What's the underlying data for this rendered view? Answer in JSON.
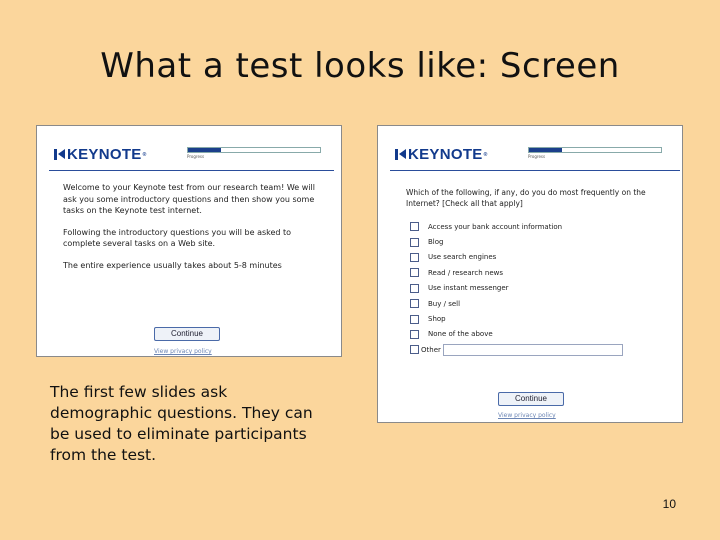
{
  "slide": {
    "title": "What a test looks like: Screen",
    "caption": "The first few slides ask demographic questions. They can be used to eliminate participants from the test.",
    "page_number": "10"
  },
  "shot1": {
    "logo": "KEYNOTE",
    "logo_tm": "®",
    "progress": 0.25,
    "progress_label": "Progress",
    "paragraphs": [
      "Welcome to your Keynote test from our research team! We will ask you some introductory questions and then show you some tasks on the Keynote test internet.",
      "Following the introductory questions you will be asked to complete several tasks on a Web site.",
      "The entire experience usually takes about 5-8 minutes"
    ],
    "continue_label": "Continue",
    "privacy_label": "View privacy policy"
  },
  "shot2": {
    "logo": "KEYNOTE",
    "logo_tm": "®",
    "progress": 0.25,
    "progress_label": "Progress",
    "question": "Which of the following, if any, do you do most frequently on the Internet? [Check all that apply]",
    "options": [
      "Access your bank account information",
      "Blog",
      "Use search engines",
      "Read / research news",
      "Use instant messenger",
      "Buy / sell",
      "Shop",
      "None of the above",
      "Other"
    ],
    "continue_label": "Continue",
    "privacy_label": "View privacy policy"
  },
  "colors": {
    "slide_background": "#fbd69c",
    "brand_blue": "#123a8c"
  }
}
